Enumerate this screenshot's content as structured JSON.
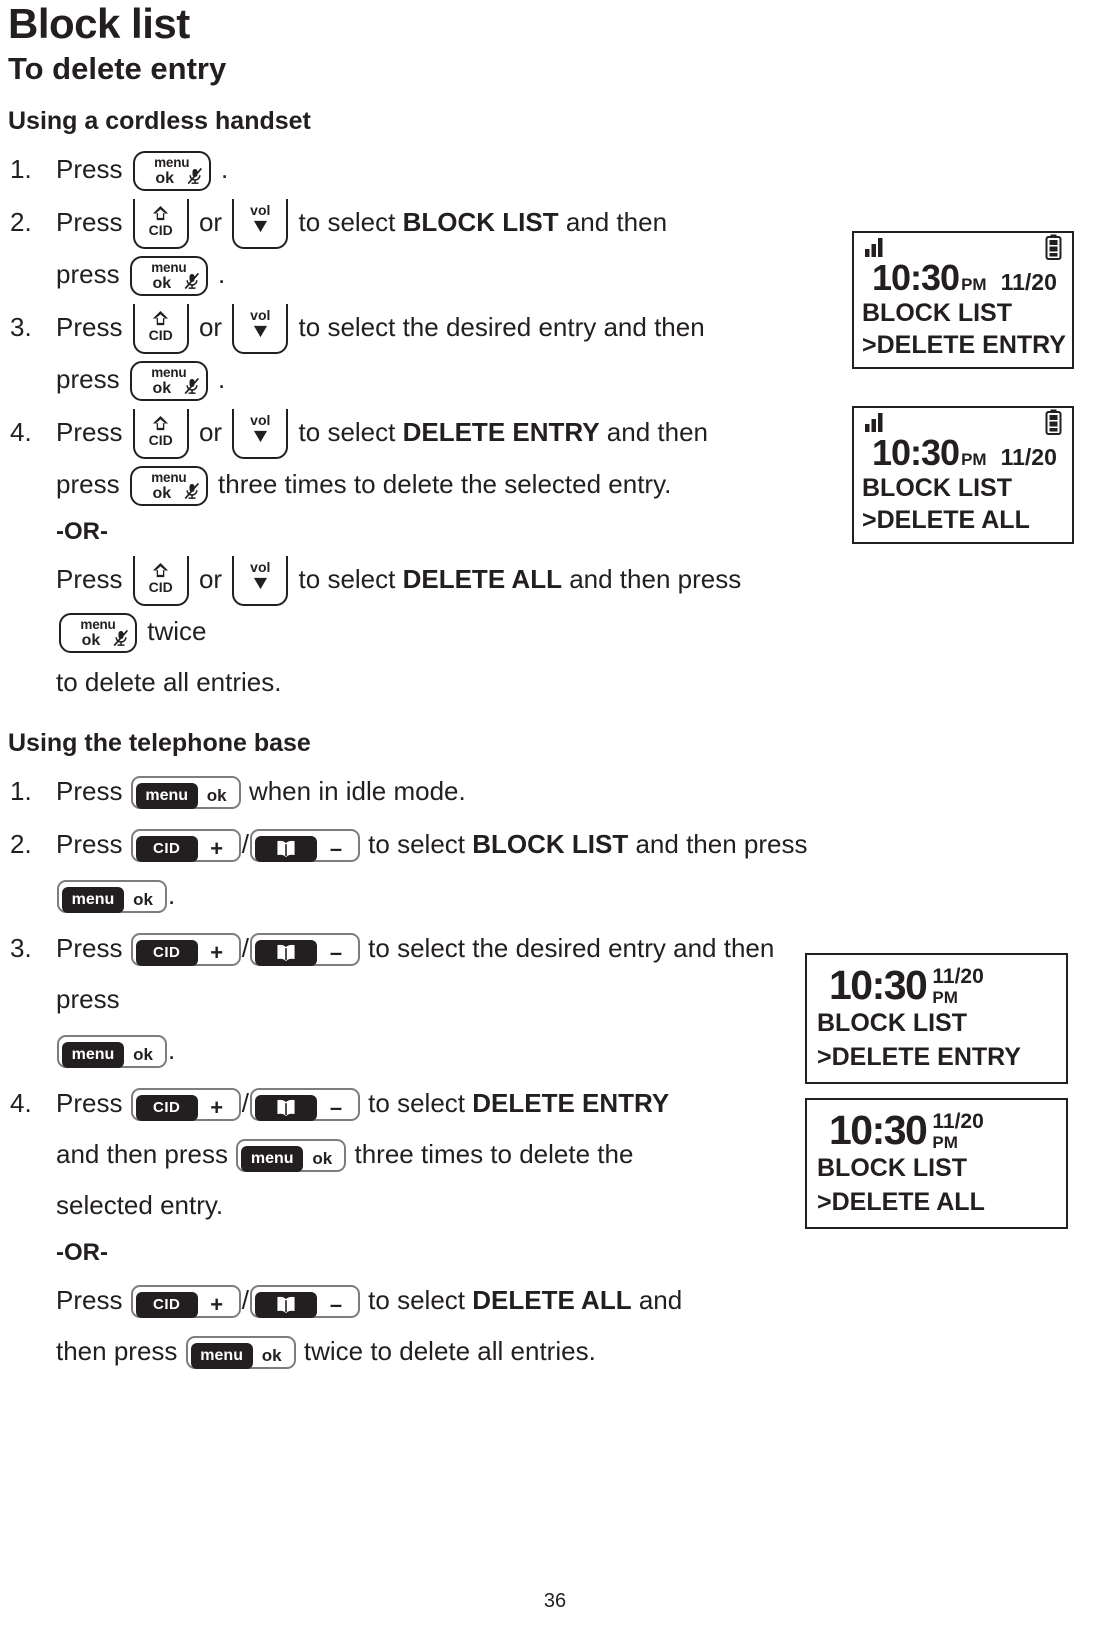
{
  "page": {
    "title": "Block list",
    "subtitle": "To delete entry",
    "number": "36"
  },
  "sections": [
    {
      "heading": "Using a cordless handset",
      "steps": [
        {
          "num": "1.",
          "parts": [
            "Press",
            "."
          ]
        },
        {
          "num": "2.",
          "l1_press": "Press",
          "l1_or": "or",
          "l1_mid": "to select",
          "l1_bold": "BLOCK LIST",
          "l1_end": "and then",
          "l2_press": "press",
          "l2_end": "."
        },
        {
          "num": "3.",
          "l1_press": "Press",
          "l1_or": "or",
          "l1_mid": "to select the desired entry and then",
          "l2_press": "press",
          "l2_end": "."
        },
        {
          "num": "4.",
          "l1_press": "Press",
          "l1_or": "or",
          "l1_mid": "to select",
          "l1_bold": "DELETE ENTRY",
          "l1_end": "and then",
          "l2_press": "press",
          "l2_end": "three times to delete the selected entry.",
          "or_label": "-OR-",
          "l3_press": "Press",
          "l3_or": "or",
          "l3_mid": "to select",
          "l3_bold": "DELETE ALL",
          "l3_end": "and then press",
          "l3_tail": "twice",
          "l4": "to delete all entries."
        }
      ]
    },
    {
      "heading": "Using the telephone base",
      "steps": [
        {
          "num": "1.",
          "l1_press": "Press",
          "l1_end": "when in idle mode."
        },
        {
          "num": "2.",
          "l1_press": "Press",
          "sep": "/",
          "l1_mid": "to select",
          "l1_bold": "BLOCK LIST",
          "l1_end": "and then press",
          "l1_tail": "."
        },
        {
          "num": "3.",
          "l1_press": "Press",
          "sep": "/",
          "l1_mid": "to select the desired entry and then press",
          "l2_end": "."
        },
        {
          "num": "4.",
          "l1_press": "Press",
          "sep": "/",
          "l1_mid": "to select",
          "l1_bold": "DELETE ENTRY",
          "l2_pre": "and then press",
          "l2_end": "three times to delete the",
          "l3": "selected entry.",
          "or_label": "-OR-",
          "l4_press": "Press",
          "l4_mid": "to select",
          "l4_bold": "DELETE ALL",
          "l4_end": "and",
          "l5_pre": "then press",
          "l5_end": "twice to delete all entries."
        }
      ]
    }
  ],
  "keys": {
    "handset_menuok": {
      "line1": "menu",
      "line2": "ok",
      "icon": "mute-mic-icon"
    },
    "handset_cid": {
      "label": "CID",
      "icon": "up-arrow-icon"
    },
    "handset_vol": {
      "label": "vol",
      "icon": "down-arrow-icon"
    },
    "base_menuok": {
      "badge": "menu",
      "side": "ok"
    },
    "base_cid": {
      "badge": "CID",
      "side": "+"
    },
    "base_dir": {
      "badge": "directory-book-icon",
      "side": "–"
    }
  },
  "displays": {
    "handset_1": {
      "signal": "signal-bars-icon",
      "battery": "battery-icon",
      "time": "10:30",
      "ampm": "PM",
      "date": "11/20",
      "line1": "BLOCK LIST",
      "line2": ">DELETE ENTRY"
    },
    "handset_2": {
      "signal": "signal-bars-icon",
      "battery": "battery-icon",
      "time": "10:30",
      "ampm": "PM",
      "date": "11/20",
      "line1": "BLOCK LIST",
      "line2": ">DELETE ALL"
    },
    "base_1": {
      "time": "10:30",
      "date": "11/20",
      "ampm": "PM",
      "line1": "BLOCK LIST",
      "line2": ">DELETE ENTRY"
    },
    "base_2": {
      "time": "10:30",
      "date": "11/20",
      "ampm": "PM",
      "line1": "BLOCK LIST",
      "line2": ">DELETE ALL"
    }
  },
  "colors": {
    "ink": "#231f20",
    "paper": "#ffffff",
    "key_border": "#7d7d7d"
  }
}
